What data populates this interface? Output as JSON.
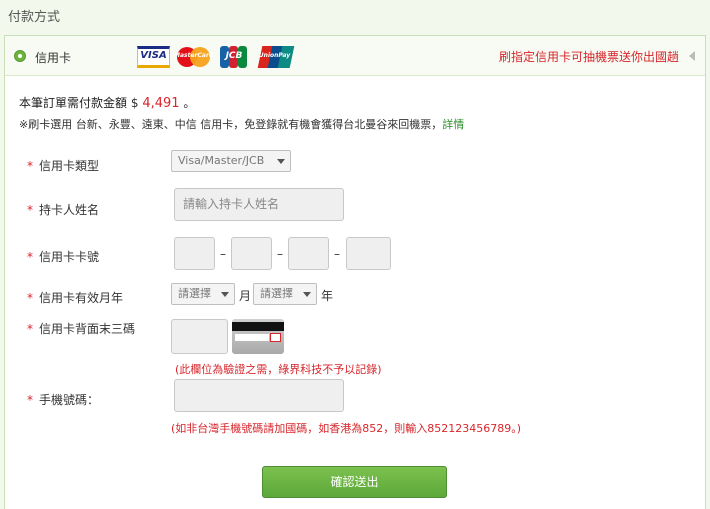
{
  "section_title": "付款方式",
  "method": {
    "label": "信用卡",
    "logos": {
      "visa": "VISA",
      "mastercard": "MasterCard",
      "jcb": "JCB",
      "unionpay": "UnionPay"
    },
    "promo": "刷指定信用卡可抽機票送你出國趟"
  },
  "amount": {
    "prefix": "本筆訂單需付款金額",
    "currency": "$",
    "value": "4,491",
    "suffix": "。"
  },
  "note": {
    "text": "※刷卡選用 台新、永豐、遠東、中信 信用卡，免登錄就有機會獲得台北曼谷來回機票，",
    "link": "詳情"
  },
  "form": {
    "required_mark": "*",
    "card_type": {
      "label": "信用卡類型",
      "value": "Visa/Master/JCB"
    },
    "holder_name": {
      "label": "持卡人姓名",
      "placeholder": "請輸入持卡人姓名"
    },
    "card_number": {
      "label": "信用卡卡號",
      "separator": "–"
    },
    "expiry": {
      "label": "信用卡有效月年",
      "month_value": "請選擇",
      "month_unit": "月",
      "year_value": "請選擇",
      "year_unit": "年"
    },
    "cvv": {
      "label": "信用卡背面末三碼",
      "hint": "(此欄位為驗證之需，綠界科技不予以記錄)"
    },
    "phone": {
      "label": "手機號碼：",
      "hint": "(如非台灣手機號碼請加國碼，如香港為852，則輸入852123456789。)"
    },
    "submit_label": "確認送出"
  },
  "colors": {
    "accent_green": "#6ab43e",
    "promo_red": "#d7262c",
    "page_bg": "#f2f9ec"
  }
}
